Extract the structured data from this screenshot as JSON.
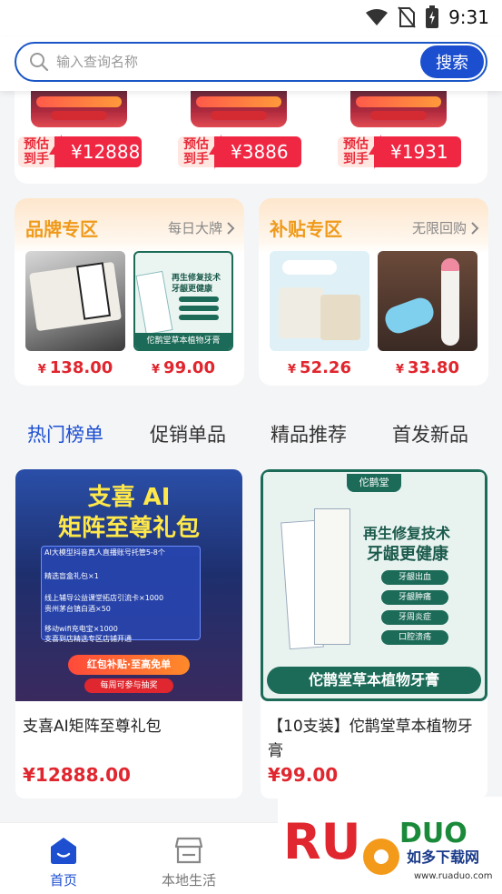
{
  "status_bar": {
    "time": "9:31"
  },
  "search": {
    "placeholder": "输入查询名称",
    "button_label": "搜索"
  },
  "top_products": [
    {
      "tag_line1": "预估",
      "tag_line2": "到手",
      "price": "¥12888"
    },
    {
      "tag_line1": "预估",
      "tag_line2": "到手",
      "price": "¥3886"
    },
    {
      "tag_line1": "预估",
      "tag_line2": "到手",
      "price": "¥1931"
    }
  ],
  "brand_zone": {
    "title": "品牌专区",
    "more": "每日大牌",
    "items": [
      {
        "currency": "¥",
        "price": "138.00"
      },
      {
        "currency": "¥",
        "price": "99.00",
        "image_text_top": "再生修复技术",
        "image_text_mid": "牙龈更健康",
        "image_text_bottom": "佗鹊堂草本植物牙膏"
      }
    ]
  },
  "subsidy_zone": {
    "title": "补贴专区",
    "more": "无限回购",
    "items": [
      {
        "currency": "¥",
        "price": "52.26"
      },
      {
        "currency": "¥",
        "price": "33.80"
      }
    ]
  },
  "tabs": [
    {
      "label": "热门榜单",
      "active": true
    },
    {
      "label": "促销单品",
      "active": false
    },
    {
      "label": "精品推荐",
      "active": false
    },
    {
      "label": "首发新品",
      "active": false
    }
  ],
  "products": [
    {
      "name": "支喜AI矩阵至尊礼包",
      "price": "¥12888.00",
      "image": {
        "headline1": "支喜 AI",
        "headline2": "矩阵至尊礼包",
        "lines": [
          "AI大模型抖音真人直播账号托管5-8个",
          "精选盲盒礼包×1",
          "线上辅导公益课堂拓店引流卡×1000",
          "贵州茅台镇白酒×50",
          "移动wifi充电宝×1000",
          "支喜到店精选专区店铺开通"
        ],
        "banner": "红包补贴·至高免单",
        "sub_banner": "每周可参与抽奖"
      }
    },
    {
      "name": "【10支装】佗鹊堂草本植物牙膏",
      "price": "¥99.00",
      "image": {
        "brand": "佗鹊堂",
        "headline1": "再生修复技术",
        "headline2": "牙龈更健康",
        "benefits": [
          "牙龈出血",
          "牙龈肿痛",
          "牙周炎症",
          "口腔溃疡"
        ],
        "footer": "佗鹊堂草本植物牙膏"
      }
    }
  ],
  "bottom_nav": [
    {
      "label": "首页",
      "icon": "home-icon",
      "active": true
    },
    {
      "label": "本地生活",
      "icon": "store-icon",
      "active": false
    }
  ],
  "watermark": {
    "brand": "RUANDUO",
    "cn": "如多下载网",
    "url": "www.ruaduo.com"
  },
  "colors": {
    "accent": "#1d4fd0",
    "price_red": "#e0262e",
    "zone_title": "#ef9a1a",
    "tag_red": "#ef2743"
  }
}
